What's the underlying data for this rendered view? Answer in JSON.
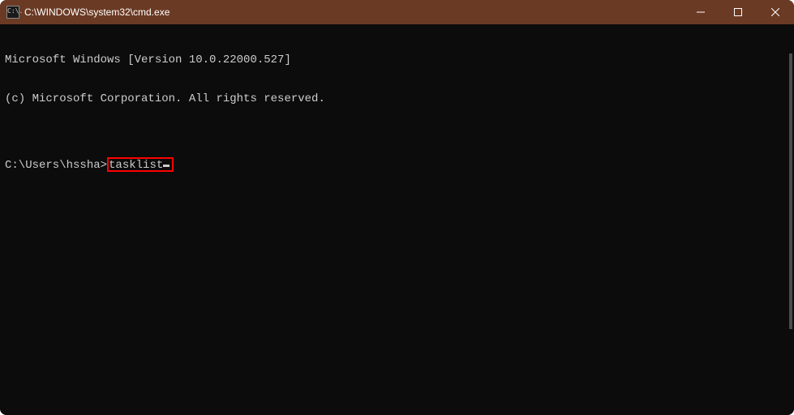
{
  "titlebar": {
    "icon_text": "C:\\.",
    "title": "C:\\WINDOWS\\system32\\cmd.exe"
  },
  "terminal": {
    "line1": "Microsoft Windows [Version 10.0.22000.527]",
    "line2": "(c) Microsoft Corporation. All rights reserved.",
    "blank": "",
    "prompt": "C:\\Users\\hssha>",
    "command": "tasklist"
  }
}
